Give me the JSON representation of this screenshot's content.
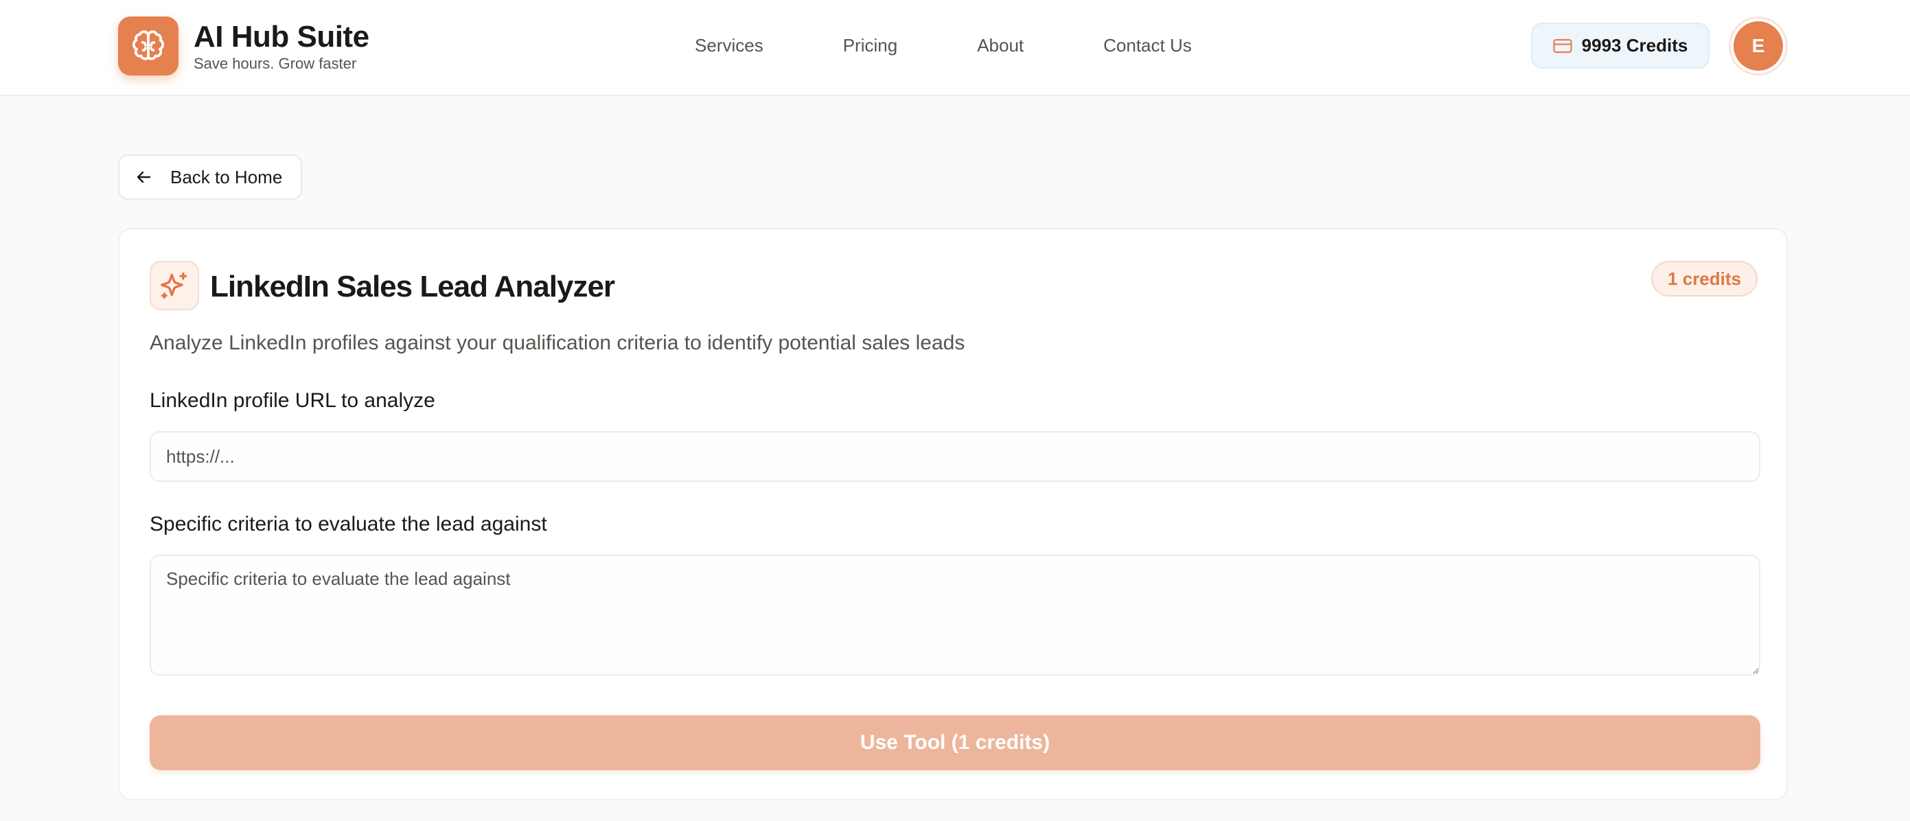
{
  "brand": {
    "title": "AI Hub Suite",
    "subtitle": "Save hours. Grow faster",
    "logo_icon": "brain-icon",
    "accent": "#e5804f"
  },
  "nav": {
    "items": [
      {
        "label": "Services"
      },
      {
        "label": "Pricing"
      },
      {
        "label": "About"
      },
      {
        "label": "Contact Us"
      }
    ]
  },
  "account": {
    "credits_label": "9993 Credits",
    "credits_icon": "credit-card-icon",
    "avatar_initial": "E"
  },
  "back": {
    "label": "Back to Home",
    "icon": "arrow-left-icon"
  },
  "tool": {
    "icon": "sparkles-icon",
    "title": "LinkedIn Sales Lead Analyzer",
    "credit_badge": "1 credits",
    "description": "Analyze LinkedIn profiles against your qualification criteria to identify potential sales leads",
    "fields": {
      "url": {
        "label": "LinkedIn profile URL to analyze",
        "placeholder": "https://...",
        "value": ""
      },
      "criteria": {
        "label": "Specific criteria to evaluate the lead against",
        "placeholder": "Specific criteria to evaluate the lead against",
        "value": ""
      }
    },
    "submit_label": "Use Tool (1 credits)"
  }
}
